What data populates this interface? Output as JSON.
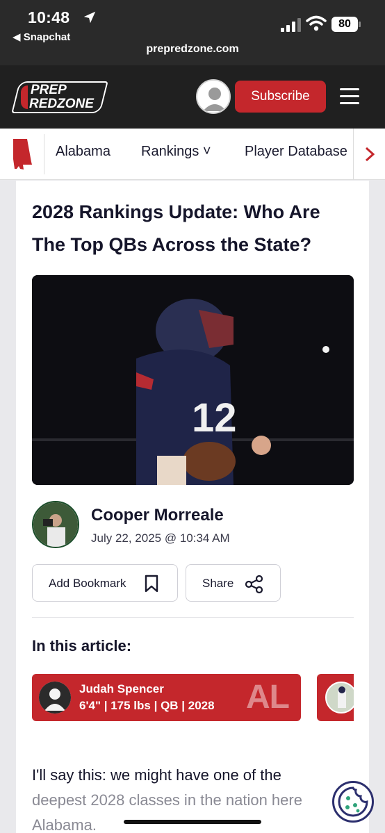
{
  "status_bar": {
    "time": "10:48",
    "back_app": "◀ Snapchat",
    "battery": "80",
    "url": "prepredzone.com"
  },
  "header": {
    "logo_line1": "PREP",
    "logo_line2": "REDZONE",
    "subscribe_label": "Subscribe",
    "brand_color": "#c4272c"
  },
  "nav": {
    "items": [
      {
        "label": "Alabama"
      },
      {
        "label": "Rankings ˅"
      },
      {
        "label": "Player Database"
      }
    ]
  },
  "article": {
    "headline": "2028 Rankings Update: Who Are The Top QBs Across the State?",
    "author": "Cooper Morreale",
    "date": "July 22, 2025 @ 10:34 AM",
    "bookmark_label": "Add Bookmark",
    "share_label": "Share",
    "in_article_label": "In this article:",
    "player": {
      "name": "Judah Spencer",
      "meta": "6'4\" | 175 lbs | QB | 2028",
      "state": "AL"
    },
    "body_line1": "I'll say this: we might have one of the",
    "body_line2": "deepest 2028 classes in the nation here",
    "body_line3": "Alabama."
  }
}
